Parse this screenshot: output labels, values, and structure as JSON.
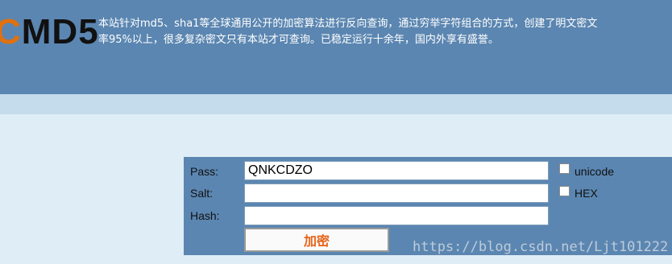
{
  "header": {
    "logo_prefix": "C",
    "logo_text": "MD5",
    "intro_line1": "本站针对md5、sha1等全球通用公开的加密算法进行反向查询，通过穷举字符组合的方式，创建了明文密文",
    "intro_line2": "率95%以上，很多复杂密文只有本站才可查询。已稳定运行十余年，国内外享有盛誉。"
  },
  "form": {
    "pass_label": "Pass:",
    "pass_value": "QNKCDZO",
    "salt_label": "Salt:",
    "salt_value": "",
    "hash_label": "Hash:",
    "hash_value": "",
    "unicode_label": "unicode",
    "hex_label": "HEX",
    "encrypt_button": "加密"
  },
  "watermark": "https://blog.csdn.net/Ljt101222",
  "colors": {
    "header_bg": "#5b86b1",
    "page_bg": "#dfedf6",
    "button_text": "#e8631a"
  }
}
